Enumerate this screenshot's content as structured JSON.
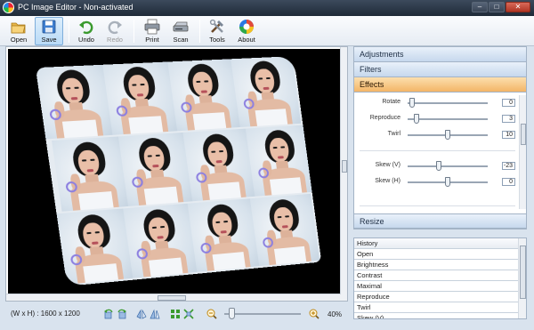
{
  "window": {
    "title": "PC Image Editor - Non-activated",
    "controls": {
      "minimize": "‒",
      "maximize": "□",
      "close": "✕"
    }
  },
  "toolbar": {
    "open": {
      "label": "Open",
      "icon": "folder-icon"
    },
    "save": {
      "label": "Save",
      "icon": "save-disk-icon"
    },
    "undo": {
      "label": "Undo",
      "icon": "undo-icon"
    },
    "redo": {
      "label": "Redo",
      "icon": "redo-icon"
    },
    "print": {
      "label": "Print",
      "icon": "printer-icon"
    },
    "scan": {
      "label": "Scan",
      "icon": "scanner-icon"
    },
    "tools": {
      "label": "Tools",
      "icon": "tools-icon"
    },
    "about": {
      "label": "About",
      "icon": "about-icon"
    }
  },
  "status": {
    "dimensions": "(W x H) : 1600 x 1200",
    "zoom": "40%",
    "zoom_level": 0.06
  },
  "panel": {
    "adjustments": "Adjustments",
    "filters": "Filters",
    "effects": "Effects",
    "resize": "Resize",
    "effects_controls": [
      {
        "label": "Rotate",
        "value": "0",
        "fraction": 0.02
      },
      {
        "label": "Reproduce",
        "value": "3",
        "fraction": 0.08
      },
      {
        "label": "Twirl",
        "value": "10",
        "fraction": 0.5
      },
      {
        "label": "Skew (V)",
        "value": "-23",
        "fraction": 0.38
      },
      {
        "label": "Skew (H)",
        "value": "0",
        "fraction": 0.5
      }
    ]
  },
  "history": {
    "items": [
      "History",
      "Open",
      "Brightness",
      "Contrast",
      "Maximal",
      "Reproduce",
      "Twirl",
      "Skew (V)"
    ]
  },
  "colors": {
    "active_tab": "#f3b567",
    "canvas_bg": "#000000",
    "toolbar_active": "#b9daf6"
  }
}
